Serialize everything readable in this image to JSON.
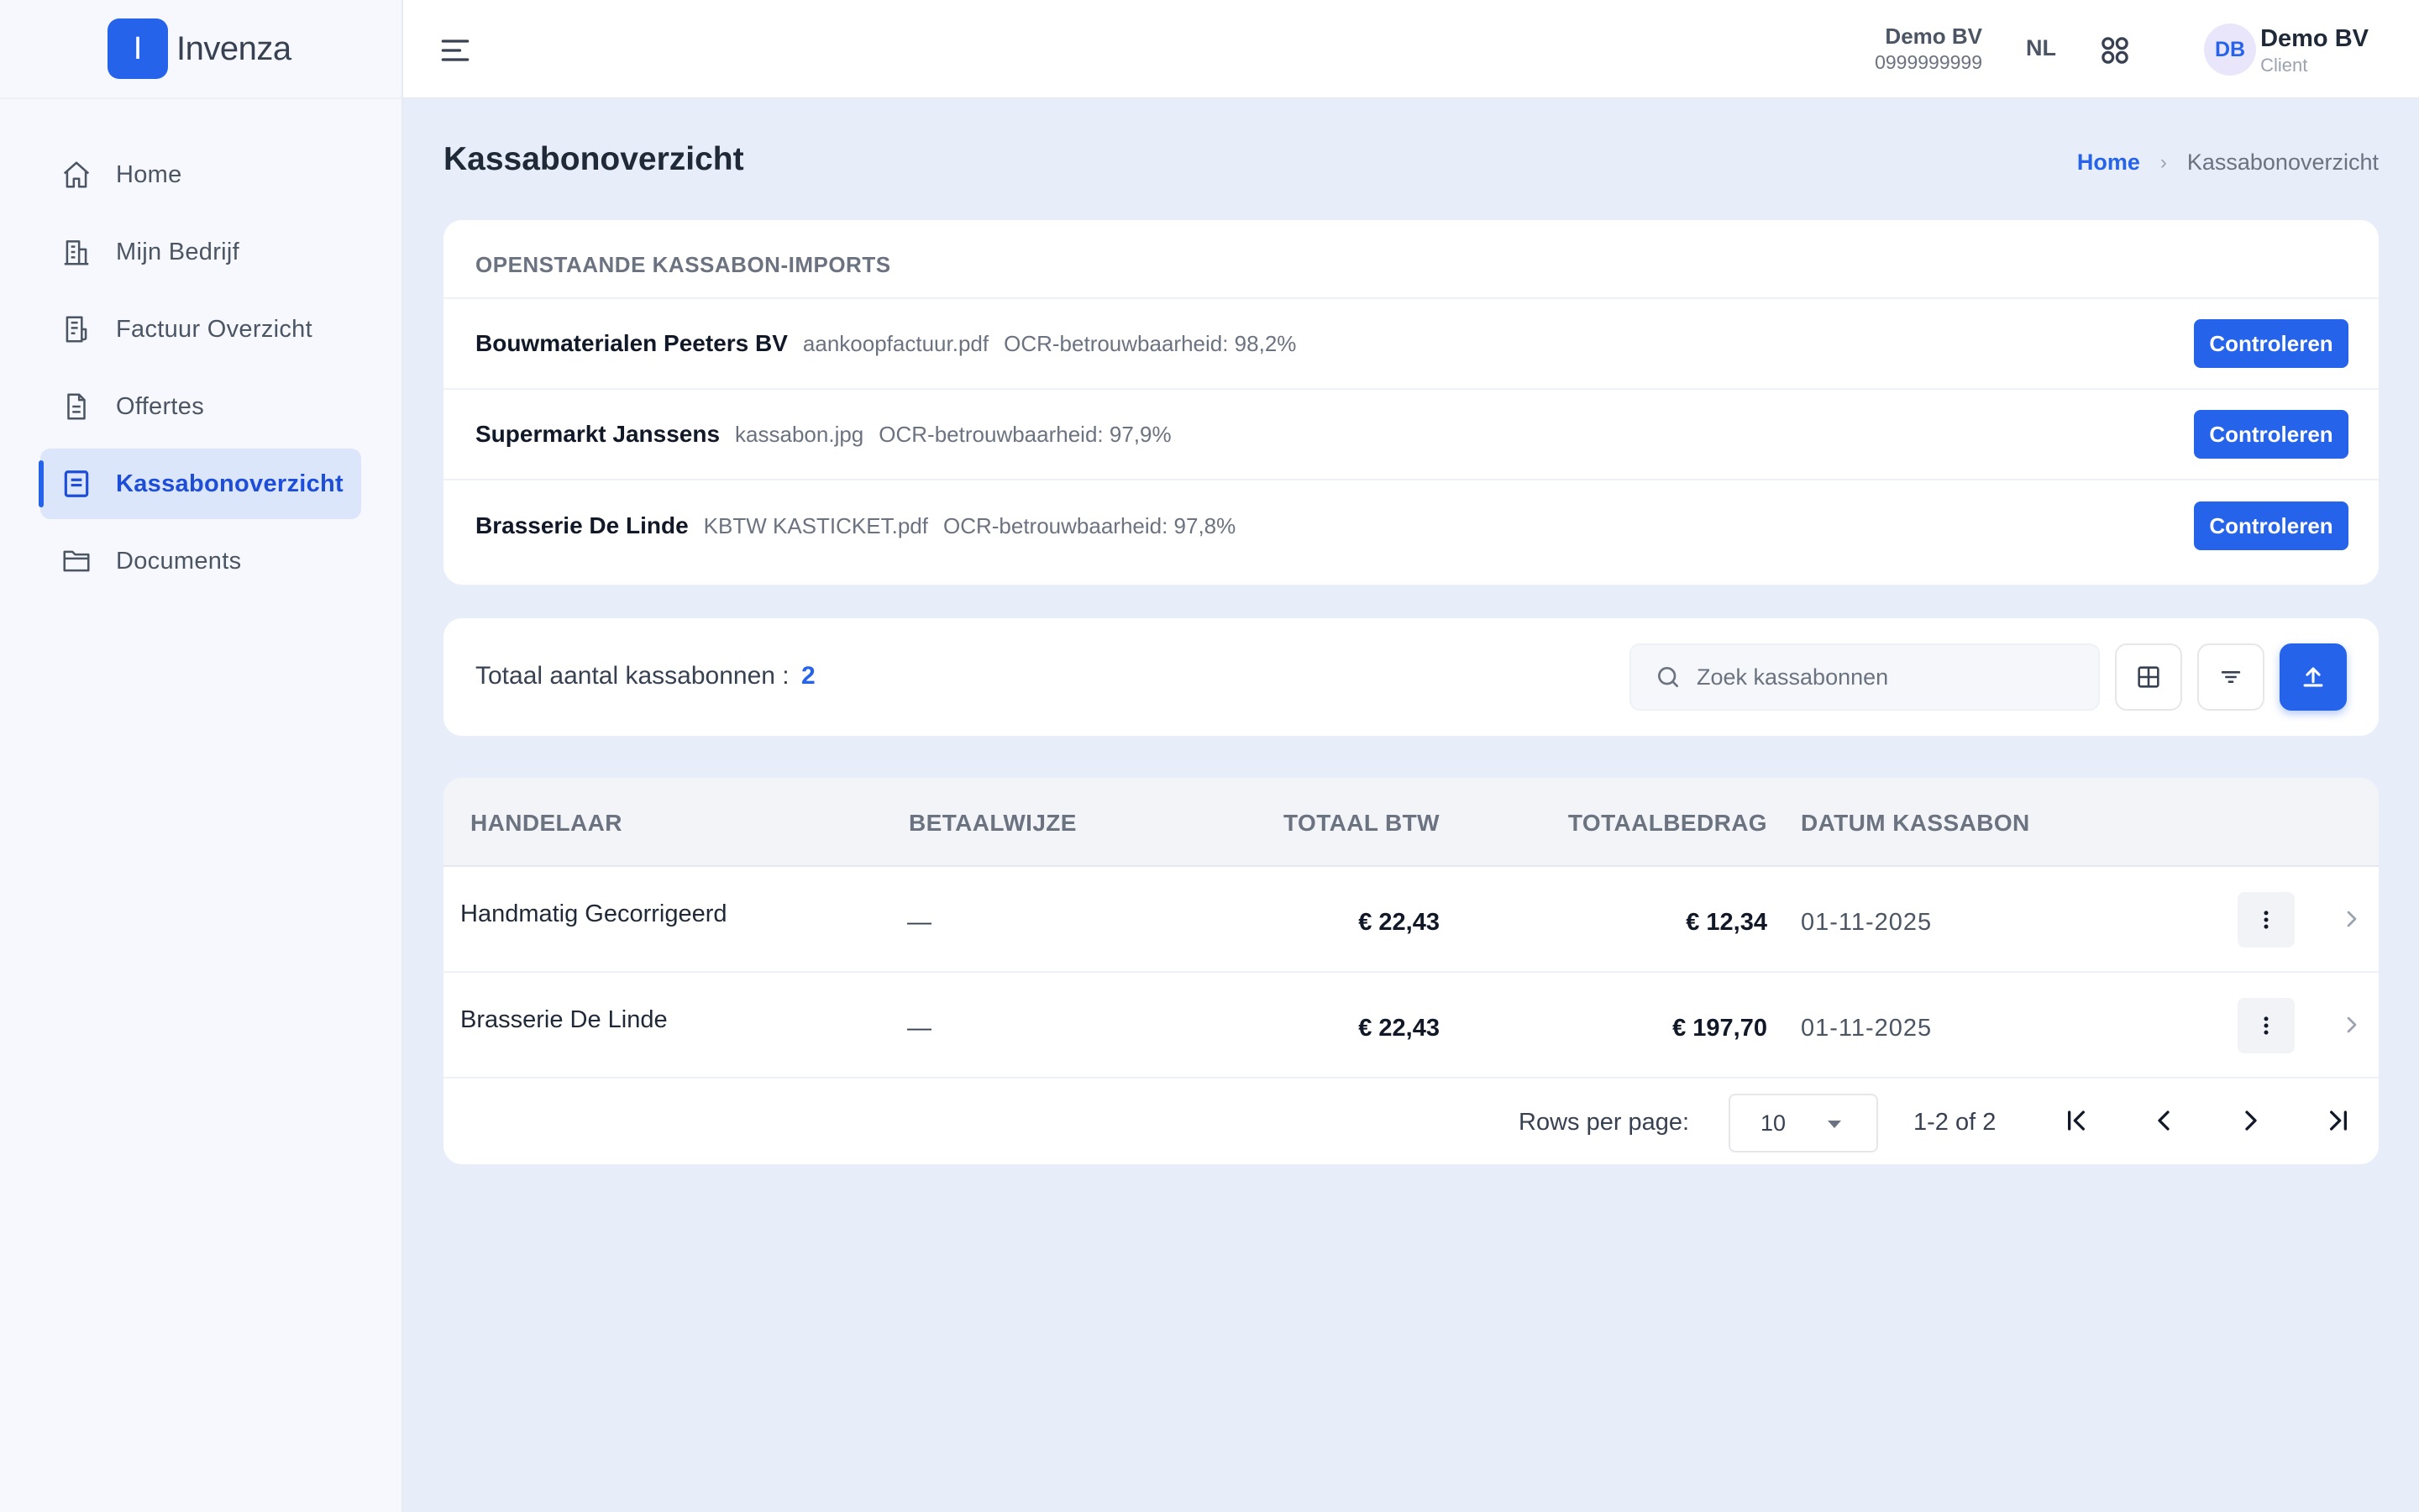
{
  "brand": {
    "logo_letter": "I",
    "name": "Invenza"
  },
  "sidebar": {
    "items": [
      {
        "label": "Home",
        "icon": "home-icon",
        "active": false
      },
      {
        "label": "Mijn Bedrijf",
        "icon": "building-icon",
        "active": false
      },
      {
        "label": "Factuur Overzicht",
        "icon": "invoice-icon",
        "active": false
      },
      {
        "label": "Offertes",
        "icon": "document-icon",
        "active": false
      },
      {
        "label": "Kassabonoverzicht",
        "icon": "receipt-icon",
        "active": true
      },
      {
        "label": "Documents",
        "icon": "folder-icon",
        "active": false
      }
    ]
  },
  "header": {
    "company_name": "Demo BV",
    "company_id": "0999999999",
    "language": "NL",
    "user_initials": "DB",
    "user_name": "Demo BV",
    "user_role": "Client"
  },
  "page": {
    "title": "Kassabonoverzicht",
    "breadcrumb": {
      "home": "Home",
      "current": "Kassabonoverzicht"
    }
  },
  "imports": {
    "title": "OPENSTAANDE KASSABON-IMPORTS",
    "rows": [
      {
        "name": "Bouwmaterialen Peeters BV",
        "file": "aankoopfactuur.pdf",
        "ocr": "OCR-betrouwbaarheid: 98,2%",
        "button": "Controleren"
      },
      {
        "name": "Supermarkt Janssens",
        "file": "kassabon.jpg",
        "ocr": "OCR-betrouwbaarheid: 97,9%",
        "button": "Controleren"
      },
      {
        "name": "Brasserie De Linde",
        "file": "KBTW KASTICKET.pdf",
        "ocr": "OCR-betrouwbaarheid: 97,8%",
        "button": "Controleren"
      }
    ]
  },
  "toolbar": {
    "total_label": "Totaal aantal kassabonnen :",
    "total_count": "2",
    "search_placeholder": "Zoek kassabonnen"
  },
  "table": {
    "columns": {
      "merchant": "HANDELAAR",
      "payment": "BETAALWIJZE",
      "vat": "TOTAAL BTW",
      "total": "TOTAALBEDRAG",
      "date": "DATUM KASSABON"
    },
    "rows": [
      {
        "merchant": "Handmatig Gecorrigeerd",
        "payment": "—",
        "vat": "€ 22,43",
        "total": "€ 12,34",
        "date": "01-11-2025"
      },
      {
        "merchant": "Brasserie De Linde",
        "payment": "—",
        "vat": "€ 22,43",
        "total": "€ 197,70",
        "date": "01-11-2025"
      }
    ]
  },
  "pagination": {
    "rows_per_page_label": "Rows per page:",
    "rows_per_page": "10",
    "range": "1-2 of 2"
  },
  "colors": {
    "accent": "#2563eb",
    "background": "#e8eef9",
    "sidebar_bg": "#f6f8fd"
  }
}
